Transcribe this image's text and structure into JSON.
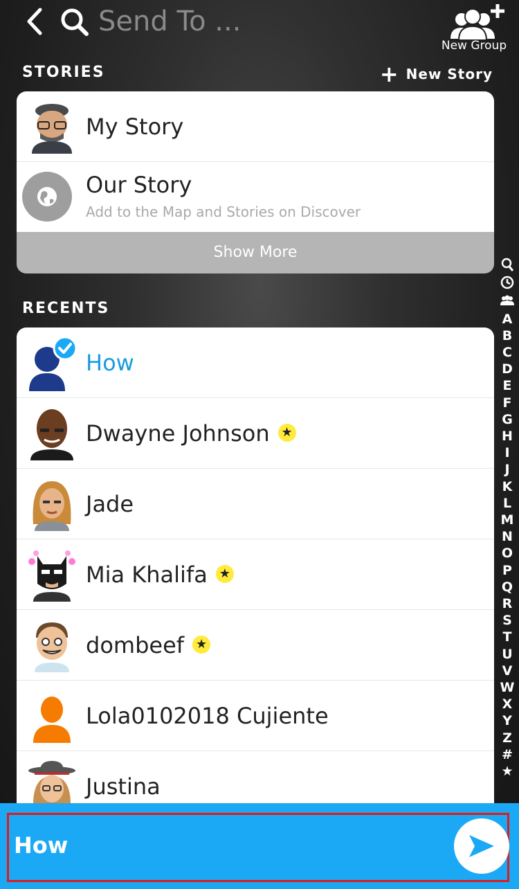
{
  "header": {
    "search_placeholder": "Send To ...",
    "new_group_label": "New Group"
  },
  "stories": {
    "section_title": "STORIES",
    "new_story_label": "New Story",
    "items": [
      {
        "name": "My Story"
      },
      {
        "name": "Our Story",
        "subtitle": "Add to the Map and Stories on Discover"
      }
    ],
    "show_more_label": "Show More"
  },
  "recents": {
    "section_title": "RECENTS",
    "items": [
      {
        "name": "How",
        "selected": true
      },
      {
        "name": "Dwayne Johnson",
        "starred": true
      },
      {
        "name": "Jade"
      },
      {
        "name": "Mia Khalifa",
        "starred": true
      },
      {
        "name": "dombeef",
        "starred": true
      },
      {
        "name": "Lola0102018 Cujiente"
      },
      {
        "name": "Justina"
      }
    ]
  },
  "alpha_index": [
    "A",
    "B",
    "C",
    "D",
    "E",
    "F",
    "G",
    "H",
    "I",
    "J",
    "K",
    "L",
    "M",
    "N",
    "O",
    "P",
    "Q",
    "R",
    "S",
    "T",
    "U",
    "V",
    "W",
    "X",
    "Y",
    "Z",
    "#"
  ],
  "send_bar": {
    "recipients_label": "How"
  },
  "colors": {
    "accent_blue": "#1BA9F5",
    "selected_name": "#1A9BE0",
    "highlight_border": "#E01B1B",
    "star_badge": "#FFEB3B"
  }
}
